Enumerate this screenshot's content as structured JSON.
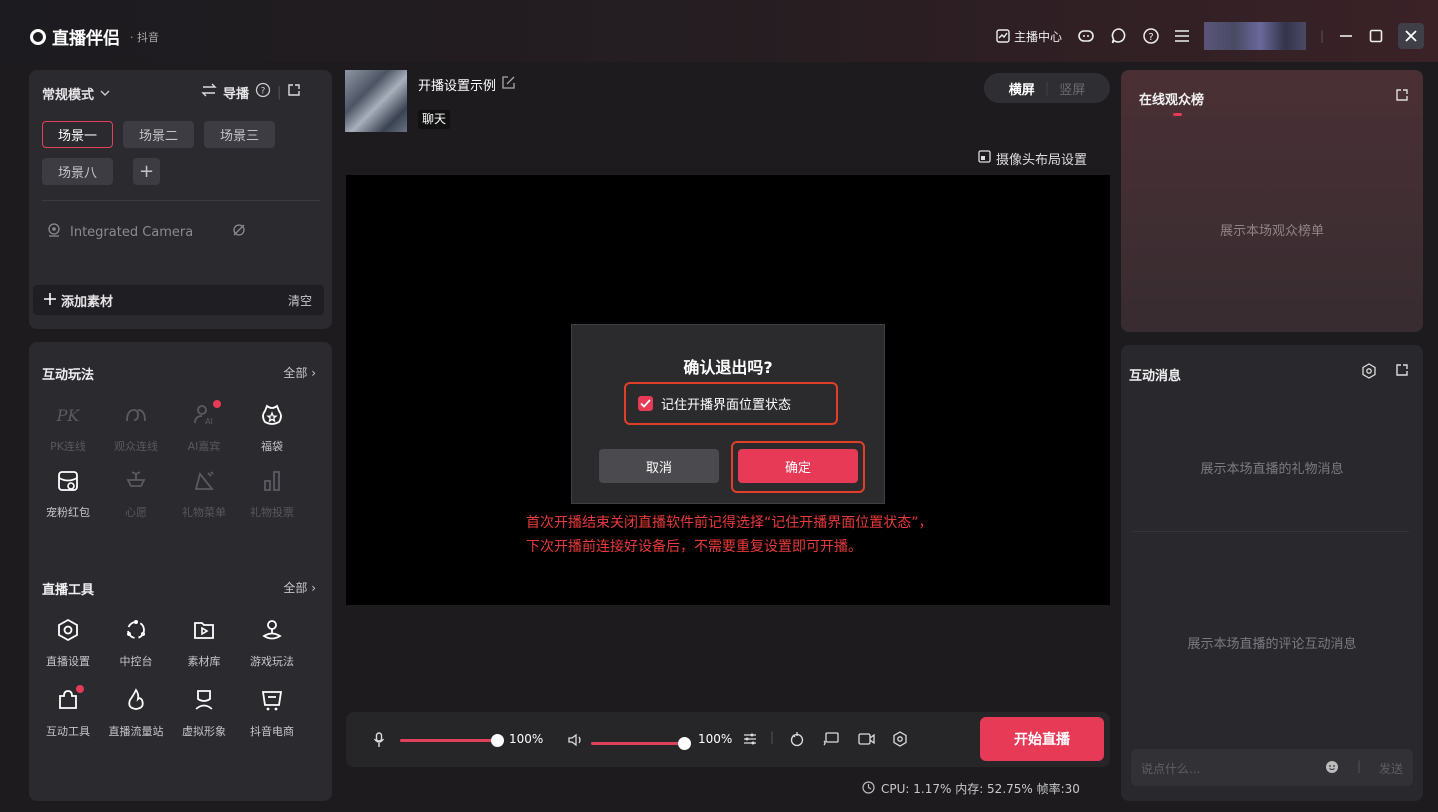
{
  "app": {
    "name": "直播伴侣",
    "sub": "· 抖音"
  },
  "topbar": {
    "anchor_center": "主播中心"
  },
  "left": {
    "mode": "常规模式",
    "guide": "导播",
    "scenes": [
      "场景一",
      "场景二",
      "场景三",
      "场景八"
    ],
    "camera": "Integrated Camera",
    "add_material": "添加素材",
    "clear": "清空",
    "interactive": {
      "title": "互动玩法",
      "all": "全部",
      "items": [
        "PK连线",
        "观众连线",
        "AI嘉宾",
        "福袋",
        "宠粉红包",
        "心愿",
        "礼物菜单",
        "礼物投票"
      ]
    },
    "tools": {
      "title": "直播工具",
      "all": "全部",
      "items": [
        "直播设置",
        "中控台",
        "素材库",
        "游戏玩法",
        "互动工具",
        "直播流量站",
        "虚拟形象",
        "抖音电商"
      ]
    }
  },
  "center": {
    "title": "开播设置示例",
    "tag": "聊天",
    "orient_h": "横屏",
    "orient_v": "竖屏",
    "camera_layout": "摄像头布局设置",
    "dialog": {
      "title": "确认退出吗?",
      "checkbox": "记住开播界面位置状态",
      "cancel": "取消",
      "ok": "确定"
    },
    "hint_line1": "首次开播结束关闭直播软件前记得选择“记住开播界面位置状态”，",
    "hint_line2": "下次开播前连接好设备后，不需要重复设置即可开播。",
    "mic_volume": "100%",
    "speaker_volume": "100%",
    "start": "开始直播",
    "status": "CPU: 1.17%   内存: 52.75%   帧率:30"
  },
  "right": {
    "audience_title": "在线观众榜",
    "audience_empty": "展示本场观众榜单",
    "messages_title": "互动消息",
    "gift_empty": "展示本场直播的礼物消息",
    "comment_empty": "展示本场直播的评论互动消息",
    "input_placeholder": "说点什么...",
    "send": "发送"
  },
  "colors": {
    "accent": "#e73a56",
    "hint": "#e83a3a",
    "highlight_box": "#e0402a"
  }
}
